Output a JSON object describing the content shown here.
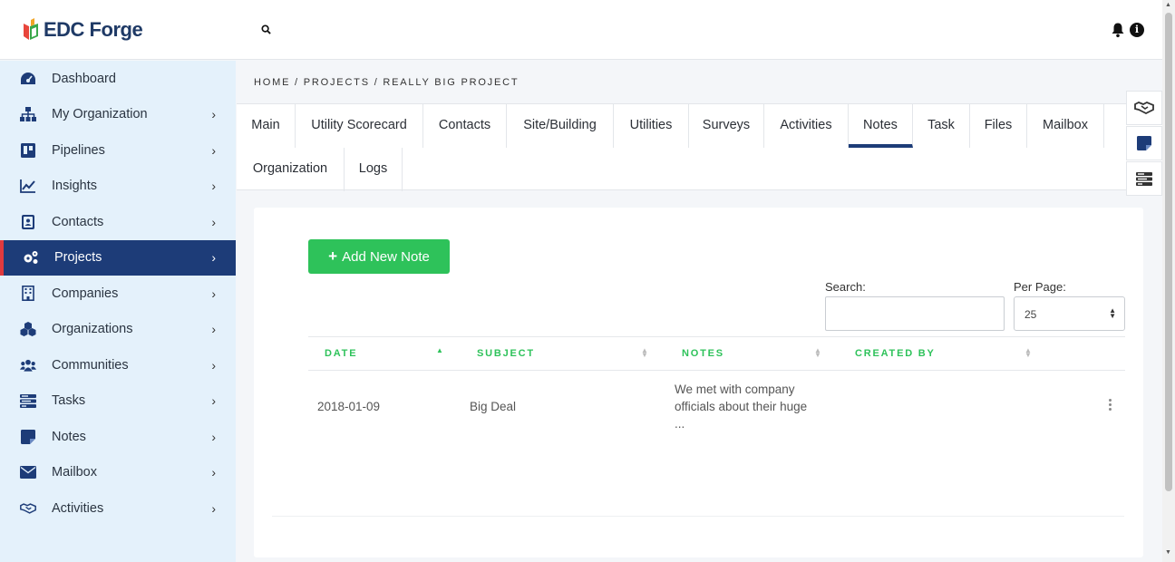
{
  "app": {
    "logo_text": "EDC Forge"
  },
  "header": {
    "search_icon": "search-icon",
    "bell_icon": "bell-icon",
    "info_icon": "info-icon"
  },
  "sidebar": {
    "items": [
      {
        "label": "Dashboard",
        "icon": "dashboard-icon",
        "chevron": false
      },
      {
        "label": "My Organization",
        "icon": "org-chart-icon",
        "chevron": true
      },
      {
        "label": "Pipelines",
        "icon": "pipeline-board-icon",
        "chevron": true
      },
      {
        "label": "Insights",
        "icon": "line-chart-icon",
        "chevron": true
      },
      {
        "label": "Contacts",
        "icon": "contact-card-icon",
        "chevron": true
      },
      {
        "label": "Projects",
        "icon": "gears-icon",
        "chevron": true,
        "active": true
      },
      {
        "label": "Companies",
        "icon": "building-icon",
        "chevron": true
      },
      {
        "label": "Organizations",
        "icon": "cubes-icon",
        "chevron": true
      },
      {
        "label": "Communities",
        "icon": "users-icon",
        "chevron": true
      },
      {
        "label": "Tasks",
        "icon": "tasks-icon",
        "chevron": true
      },
      {
        "label": "Notes",
        "icon": "sticky-note-icon",
        "chevron": true
      },
      {
        "label": "Mailbox",
        "icon": "envelope-icon",
        "chevron": true
      },
      {
        "label": "Activities",
        "icon": "handshake-icon",
        "chevron": true
      }
    ]
  },
  "breadcrumb": "HOME / PROJECTS / REALLY BIG PROJECT",
  "tabs": [
    {
      "label": "Main"
    },
    {
      "label": "Utility Scorecard"
    },
    {
      "label": "Contacts"
    },
    {
      "label": "Site/Building"
    },
    {
      "label": "Utilities"
    },
    {
      "label": "Surveys"
    },
    {
      "label": "Activities"
    },
    {
      "label": "Notes",
      "active": true
    },
    {
      "label": "Task"
    },
    {
      "label": "Files"
    },
    {
      "label": "Mailbox"
    },
    {
      "label": "Organization"
    },
    {
      "label": "Logs"
    }
  ],
  "notes": {
    "add_button_label": "Add New Note",
    "search_label": "Search:",
    "search_value": "",
    "per_page_label": "Per Page:",
    "per_page_value": "25",
    "columns": [
      "DATE",
      "SUBJECT",
      "NOTES",
      "CREATED BY"
    ],
    "rows": [
      {
        "date": "2018-01-09",
        "subject": "Big Deal",
        "notes_line1": "We met with company",
        "notes_line2": "officials about their huge",
        "notes_line3": "...",
        "created_by": ""
      }
    ]
  },
  "colors": {
    "accent": "#1d3c78",
    "green": "#2ec25a",
    "sidebar_bg": "#e4f1fb",
    "active_marker": "#e03a3e"
  }
}
